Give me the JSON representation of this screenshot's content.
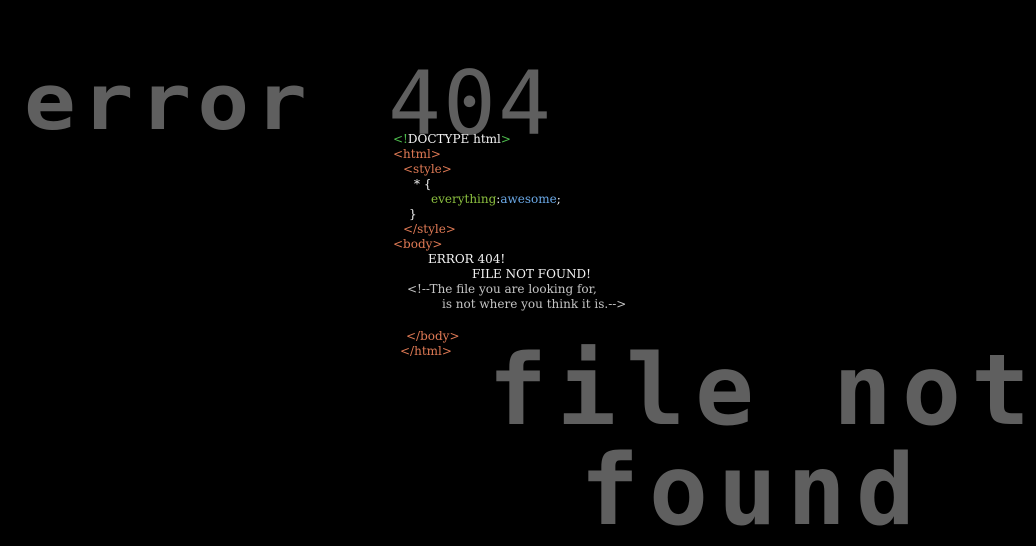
{
  "background_color": "#000000",
  "big_text": {
    "error": "error",
    "number": "404",
    "file_not": "file not",
    "found": "found",
    "color": "#5f5f5f"
  },
  "code": {
    "doctype_open": "<!",
    "doctype_text": "DOCTYPE html",
    "doctype_close": ">",
    "html_open": "<html>",
    "style_open": "<style>",
    "selector": "* {",
    "property": "everything",
    "colon": ":",
    "value": "awesome",
    "semicolon": ";",
    "brace_close": "}",
    "style_close": "</style>",
    "body_open": "<body>",
    "error_line": "ERROR 404!",
    "not_found_line": "FILE NOT FOUND!",
    "comment_line1": "<!--The file you are looking for,",
    "comment_line2": "is not where you think it is.-->",
    "body_close": "</body>",
    "html_close": "</html>"
  },
  "colors": {
    "tag": "#e07a55",
    "text": "#f2f2f2",
    "doctype_bracket": "#4fc04f",
    "property": "#8bbf3f",
    "value": "#6aa8e6",
    "comment": "#c4c4c4"
  }
}
